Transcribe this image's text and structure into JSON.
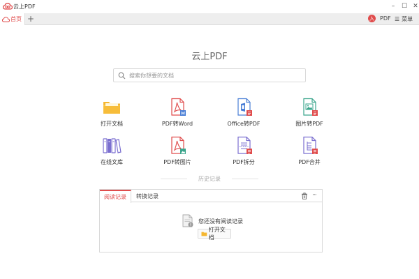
{
  "window": {
    "title": "云上PDF",
    "minimize_glyph": "–",
    "maximize_glyph": "☐",
    "close_glyph": "✕"
  },
  "tabbar": {
    "home_tab": "首页",
    "add_glyph": "+",
    "user_avatar": "入",
    "pdf_label": "PDF",
    "menu_label": "菜单"
  },
  "main": {
    "title": "云上PDF",
    "search": {
      "placeholder": "搜索你想要的文档",
      "value": ""
    }
  },
  "tools": [
    {
      "label": "打开文档",
      "icon": "folder-icon"
    },
    {
      "label": "PDF转Word",
      "icon": "pdf-to-word-icon"
    },
    {
      "label": "Office转PDF",
      "icon": "office-to-pdf-icon"
    },
    {
      "label": "图片转PDF",
      "icon": "image-to-pdf-icon"
    },
    {
      "label": "在线文库",
      "icon": "library-icon"
    },
    {
      "label": "PDF转图片",
      "icon": "pdf-to-image-icon"
    },
    {
      "label": "PDF拆分",
      "icon": "pdf-split-icon"
    },
    {
      "label": "PDF合并",
      "icon": "pdf-merge-icon"
    }
  ],
  "history": {
    "title": "历史记录",
    "tabs": [
      "阅读记录",
      "转换记录"
    ],
    "empty_message": "您还没有阅读记录",
    "open_button": "打开文档",
    "more_glyph": "···"
  },
  "colors": {
    "accent_red": "#e04c4c",
    "folder_yellow": "#f5b731",
    "blue": "#4a7fd6",
    "teal": "#3aa58c",
    "purple": "#7b6fd0"
  }
}
